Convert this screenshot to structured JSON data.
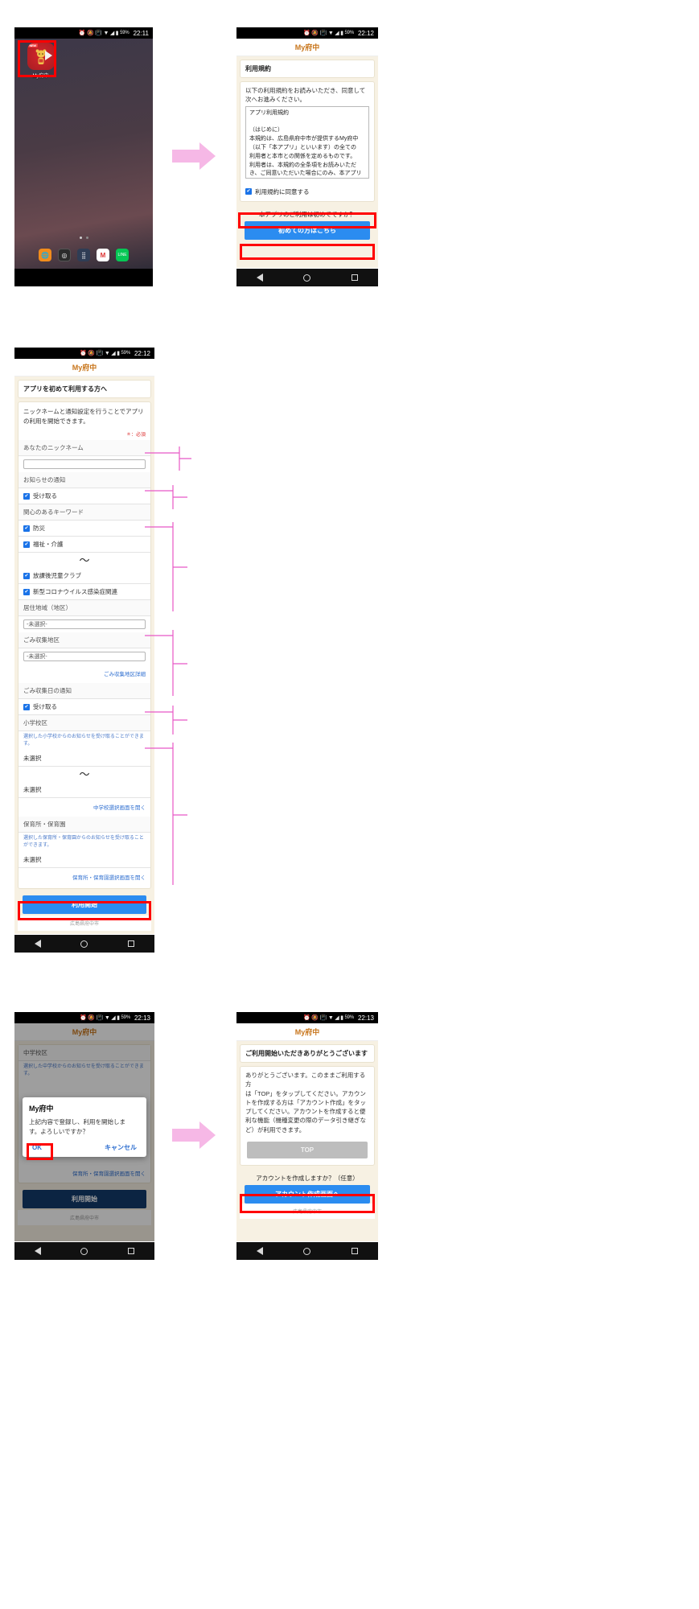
{
  "app": {
    "name": "My府中",
    "footer": "広島県府中市"
  },
  "screens": {
    "home": {
      "status_time": "22:11",
      "battery": "59%",
      "app_label": "My府中",
      "new_badge": "NEW"
    },
    "terms": {
      "status_time": "22:12",
      "battery": "59%",
      "header": "My府中",
      "card_title": "利用規約",
      "intro_line1": "以下の利用規約をお読みいただき、同意して",
      "intro_line2": "次へお進みください。",
      "terms_text": [
        "アプリ利用規約",
        "",
        "（はじめに）",
        "本規約は、広島県府中市が提供するMy府中",
        "（以下「本アプリ」といいます）の全ての",
        "利用者と本市との関係を定めるものです。",
        "利用者は、本規約の全条項をお読みいただ",
        "き、ご同意いただいた場合にのみ、本アプリ"
      ],
      "agree_label": "利用規約に同意する",
      "agree_checked": true,
      "question": "本アプリのご利用は初めてですか？",
      "primary_button": "初めての方はこちら"
    },
    "form": {
      "status_time": "22:12",
      "battery": "59%",
      "header": "My府中",
      "card_title": "アプリを初めて利用する方へ",
      "hint_line1": "ニックネームと通知設定を行うことでアプリ",
      "hint_line2": "の利用を開始できます。",
      "required_note": "＊：必須",
      "fields": [
        {
          "type": "label",
          "text": "あなたのニックネーム"
        },
        {
          "type": "input",
          "value": "",
          "placeholder": ""
        },
        {
          "type": "label",
          "text": "お知らせの通知"
        },
        {
          "type": "check",
          "text": "受け取る",
          "checked": true
        },
        {
          "type": "label",
          "text": "関心のあるキーワード"
        },
        {
          "type": "check",
          "text": "防災",
          "checked": true
        },
        {
          "type": "check",
          "text": "福祉・介護",
          "checked": true
        },
        {
          "type": "squiggle",
          "text": "〜"
        },
        {
          "type": "check",
          "text": "放課後児童クラブ",
          "checked": true
        },
        {
          "type": "check",
          "text": "新型コロナウイルス感染症関連",
          "checked": true
        },
        {
          "type": "label",
          "text": "居住地域（地区）"
        },
        {
          "type": "select",
          "value": "-未選択-"
        },
        {
          "type": "label",
          "text": "ごみ収集地区"
        },
        {
          "type": "select",
          "value": "-未選択-"
        },
        {
          "type": "linkright",
          "text": "ごみ収集地区詳細"
        },
        {
          "type": "label",
          "text": "ごみ収集日の通知"
        },
        {
          "type": "check",
          "text": "受け取る",
          "checked": true
        },
        {
          "type": "label",
          "text": "小学校区"
        },
        {
          "type": "helper",
          "text": "選択した小学校からのお知らせを受け取ることができます。"
        },
        {
          "type": "value",
          "text": "未選択"
        },
        {
          "type": "squiggle",
          "text": "〜"
        },
        {
          "type": "value",
          "text": "未選択"
        },
        {
          "type": "linkright",
          "text": "中学校選択画面を開く"
        },
        {
          "type": "label",
          "text": "保育所・保育園"
        },
        {
          "type": "helper",
          "text": "選択した保育所・保育園からのお知らせを受け取ることができます。"
        },
        {
          "type": "value",
          "text": "未選択"
        },
        {
          "type": "linkright",
          "text": "保育所・保育園選択画面を開く"
        }
      ],
      "submit_button": "利用開始",
      "footer": "広島県府中市"
    },
    "confirm": {
      "status_time": "22:13",
      "battery": "59%",
      "header": "My府中",
      "bg_label": "中学校区",
      "bg_helper": "選択した中学校からのお知らせを受け取ることができます。",
      "bg_link": "保育所・保育園選択画面を開く",
      "bg_button": "利用開始",
      "footer": "広島県府中市",
      "dialog": {
        "title": "My府中",
        "message_line1": "上記内容で登録し、利用を開始しま",
        "message_line2": "す。よろしいですか？",
        "ok": "OK",
        "cancel": "キャンセル"
      }
    },
    "done": {
      "status_time": "22:13",
      "battery": "59%",
      "header": "My府中",
      "card_title": "ご利用開始いただきありがとうございます",
      "body_lines": [
        "ありがとうございます。このままご利用する方",
        "は「TOP」をタップしてください。アカウン",
        "トを作成する方は「アカウント作成」をタッ",
        "プしてください。アカウントを作成すると便",
        "利な機能（機種変更の際のデータ引き継ぎな",
        "ど）が利用できます。"
      ],
      "top_button": "TOP",
      "account_question": "アカウントを作成しますか？（任意）",
      "account_button": "アカウント作成画面へ",
      "footer": "広島県府中市"
    }
  },
  "icons": {
    "alarm": "⏰",
    "notify": "🔔",
    "vibrate": "📳",
    "wifi": "▼",
    "signal": "◢",
    "battery": "▮",
    "back": "back-triangle",
    "home": "home-circle",
    "recents": "recents-square",
    "arrow": "right-arrow"
  },
  "colors": {
    "brand": "#c8751b",
    "primary_button": "#2b8cf0",
    "navy_button": "#123a6b",
    "highlight": "#ff0000",
    "annotation": "#e857c6",
    "arrow": "#f6b8e6",
    "page_bg": "#f7f1e3"
  }
}
